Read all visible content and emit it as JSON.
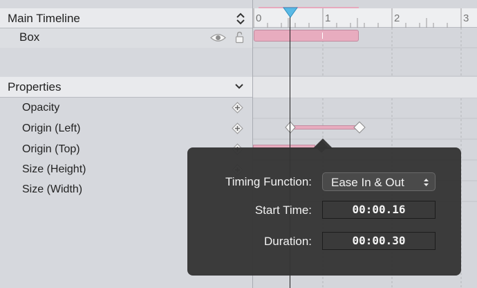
{
  "timeline": {
    "header_label": "Main Timeline",
    "layer_name": "Box",
    "ruler_labels": [
      "0",
      "1",
      "2",
      "3"
    ]
  },
  "properties": {
    "header_label": "Properties",
    "items": [
      "Opacity",
      "Origin (Left)",
      "Origin (Top)",
      "Size (Height)",
      "Size (Width)"
    ]
  },
  "popover": {
    "timing_function_label": "Timing Function:",
    "timing_function_value": "Ease In & Out",
    "start_time_label": "Start Time:",
    "start_time_value": "00:00.16",
    "duration_label": "Duration:",
    "duration_value": "00:00.30"
  },
  "colors": {
    "keyframe_bar": "#e8acbf",
    "playhead": "#59b9e6",
    "popover_bg": "#343434"
  },
  "icons": {
    "visibility": "eye-icon",
    "lock": "lock-icon",
    "add_keyframe": "diamond-plus-icon",
    "sort": "chevron-updown-icon",
    "collapse": "chevron-down-icon"
  }
}
